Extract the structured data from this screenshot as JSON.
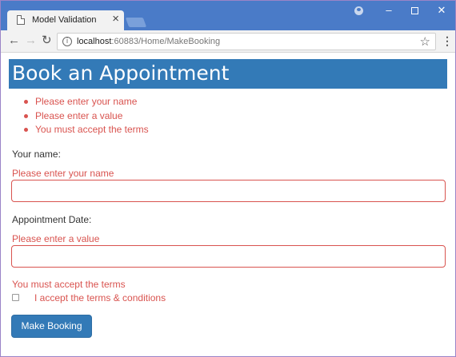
{
  "browser": {
    "tab_title": "Model Validation",
    "url_host": "localhost",
    "url_rest": ":60883/Home/MakeBooking"
  },
  "page": {
    "title": "Book an Appointment",
    "validation_summary": [
      "Please enter your name",
      "Please enter a value",
      "You must accept the terms"
    ],
    "name_label": "Your name:",
    "name_error": "Please enter your name",
    "name_value": "",
    "date_label": "Appointment Date:",
    "date_error": "Please enter a value",
    "date_value": "",
    "terms_error": "You must accept the terms",
    "terms_label": "I accept the terms & conditions",
    "terms_checked": false,
    "submit_label": "Make Booking"
  },
  "colors": {
    "accent": "#337ab7",
    "error": "#d9534f",
    "chrome": "#4a7bc8"
  },
  "icons": [
    "page-icon",
    "tab-close-icon",
    "profile-icon",
    "back-arrow-icon",
    "forward-arrow-icon",
    "reload-icon",
    "info-icon",
    "star-icon",
    "menu-icon"
  ]
}
